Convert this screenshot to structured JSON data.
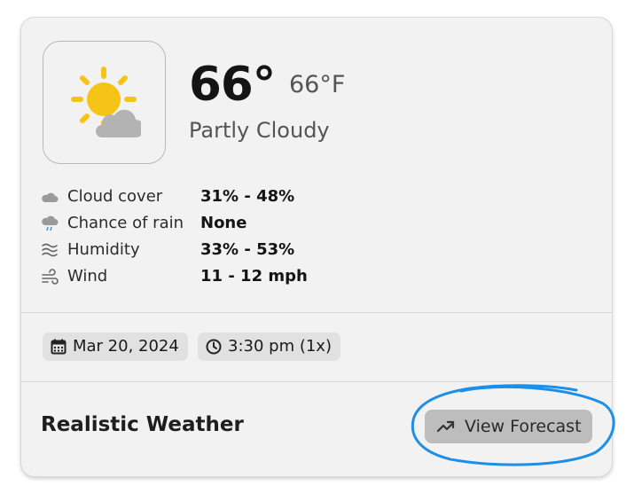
{
  "current": {
    "temp_display": "66°",
    "temp_unit_display": "66°F",
    "condition": "Partly Cloudy",
    "weather_icon": "partly-cloudy-icon"
  },
  "stats": [
    {
      "icon": "cloud-icon",
      "label": "Cloud cover",
      "value": "31% - 48%"
    },
    {
      "icon": "rain-cloud-icon",
      "label": "Chance of rain",
      "value": "None"
    },
    {
      "icon": "humidity-icon",
      "label": "Humidity",
      "value": "33% - 53%"
    },
    {
      "icon": "wind-icon",
      "label": "Wind",
      "value": "11 - 12 mph"
    }
  ],
  "meta": {
    "date": "Mar 20, 2024",
    "time": "3:30 pm (1x)"
  },
  "footer": {
    "brand": "Realistic Weather",
    "forecast_button": "View Forecast"
  },
  "colors": {
    "card_bg": "#f2f2f2",
    "button_bg": "#bdbdbd",
    "sun": "#f6c417",
    "cloud": "#b3b3b3",
    "annotation": "#1e8fe6"
  }
}
